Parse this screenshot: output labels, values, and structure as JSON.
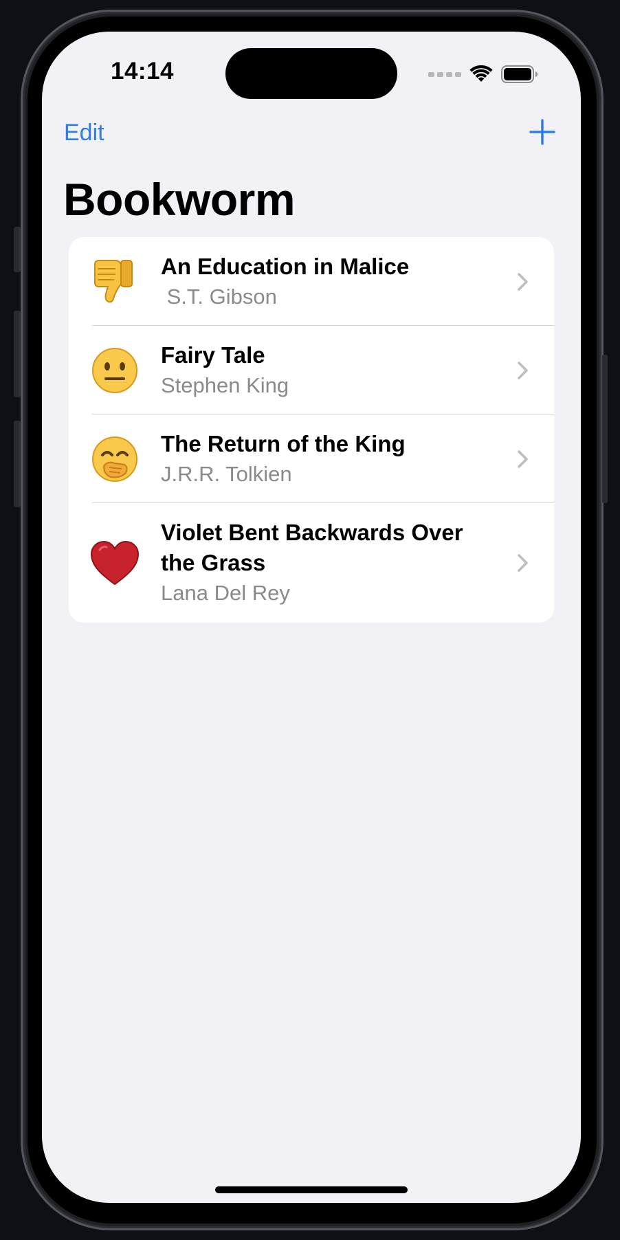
{
  "status_bar": {
    "time": "14:14",
    "icons": [
      "cellular-signal-icon",
      "wifi-icon",
      "battery-icon"
    ]
  },
  "nav": {
    "edit_label": "Edit",
    "add_icon": "plus-icon",
    "title": "Bookworm"
  },
  "books": [
    {
      "emoji": "thumbs-down",
      "title": "An Education in Malice",
      "author": " S.T. Gibson"
    },
    {
      "emoji": "neutral-face",
      "title": "Fairy Tale",
      "author": "Stephen King"
    },
    {
      "emoji": "face-with-hand-over-mouth",
      "title": "The Return of the King",
      "author": "J.R.R. Tolkien"
    },
    {
      "emoji": "red-heart",
      "title": "Violet Bent Backwards Over the Grass",
      "author": "Lana Del Rey"
    }
  ],
  "colors": {
    "accent": "#2f7de6",
    "background": "#f1f1f6",
    "secondary_text": "#8a8a8e"
  }
}
